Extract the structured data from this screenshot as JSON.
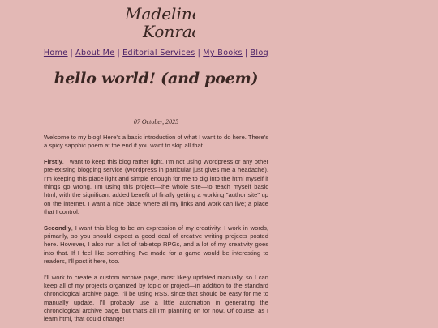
{
  "site": {
    "logo_line1": "Madeline",
    "logo_line2": "Konrad"
  },
  "nav": {
    "items": [
      {
        "label": "Home"
      },
      {
        "label": "About Me"
      },
      {
        "label": "Editorial Services"
      },
      {
        "label": "My Books"
      },
      {
        "label": "Blog"
      }
    ],
    "separator": "|"
  },
  "post": {
    "title": "hello world! (and poem)",
    "date": "07 October, 2025",
    "paragraphs": [
      {
        "lead": "",
        "text": "Welcome to my blog! Here's a basic introduction of what I want to do here. There's a spicy sapphic poem at the end if you want to skip all that."
      },
      {
        "lead": "Firstly",
        "text": ", I want to keep this blog rather light. I'm not using Wordpress or any other pre-existing blogging service (Wordpress in particular just gives me a headache). I'm keeping this place light and simple enough for me to dig into the html myself if things go wrong. I'm using this project—the whole site—to teach myself basic html, with the significant added benefit of finally getting a working \"author site\" up on the internet. I want a nice place where all my links and work can live; a place that I control."
      },
      {
        "lead": "Secondly",
        "text": ", I want this blog to be an expression of my creativity. I work in words, primarily, so you should expect a good deal of creative writing projects posted here. However, I also run a lot of tabletop RPGs, and a lot of my creativity goes into that. If I feel like something I've made for a game would be interesting to readers, I'll post it here, too."
      },
      {
        "lead": "",
        "text": "I'll work to create a custom archive page, most likely updated manually, so I can keep all of my projects organized by topic or project—in addition to the standard chronological archive page. I'll be using RSS, since that should be easy for me to manually update. I'll probably use a little automation in generating the chronological archive page, but that's all I'm planning on for now. Of course, as I learn html, that could change!"
      }
    ]
  }
}
